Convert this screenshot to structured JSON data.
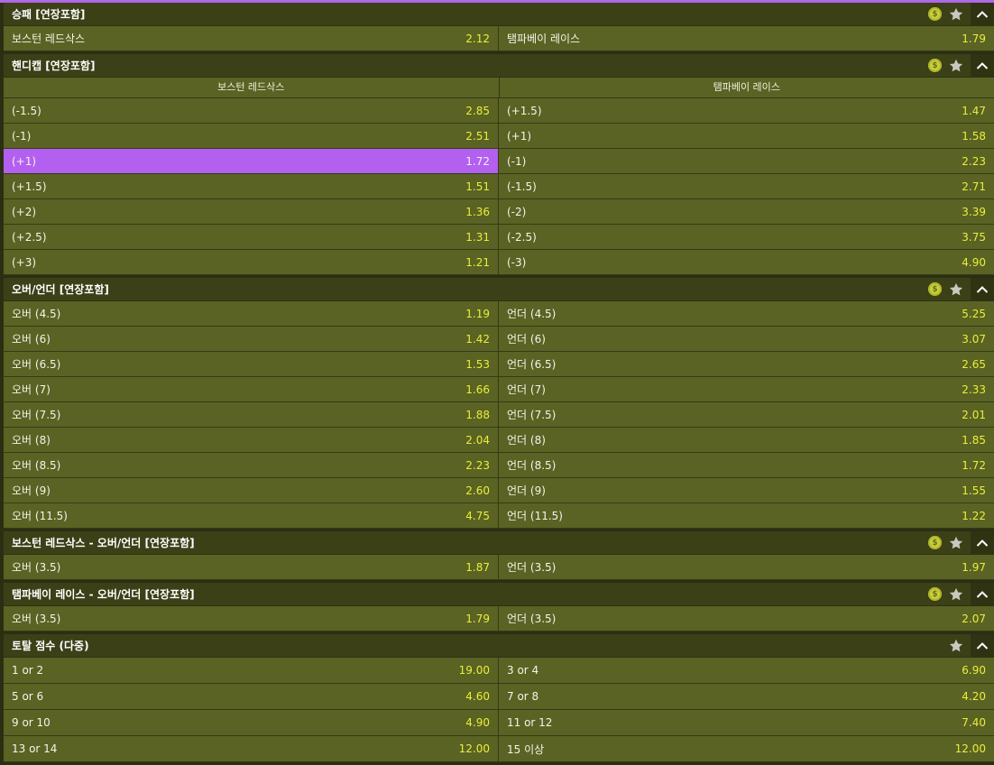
{
  "colors": {
    "accent": "#b266e8",
    "odds": "#e8ef3a",
    "row": "#5a6323",
    "header": "#3b4017"
  },
  "icons": {
    "coin": "coin-icon",
    "star": "star-icon",
    "collapse": "chevron-up-icon"
  },
  "coin_symbol": "$",
  "markets": [
    {
      "title": "승패 [연장포함]",
      "coin": true,
      "rows": [
        [
          {
            "label": "보스턴 레드삭스",
            "odds": "2.12"
          },
          {
            "label": "탬파베이 레이스",
            "odds": "1.79"
          }
        ]
      ]
    },
    {
      "title": "핸디캡 [연장포함]",
      "coin": true,
      "teams": [
        "보스턴 레드삭스",
        "탬파베이 레이스"
      ],
      "rows": [
        [
          {
            "label": "(-1.5)",
            "odds": "2.85"
          },
          {
            "label": "(+1.5)",
            "odds": "1.47"
          }
        ],
        [
          {
            "label": "(-1)",
            "odds": "2.51"
          },
          {
            "label": "(+1)",
            "odds": "1.58"
          }
        ],
        [
          {
            "label": "(+1)",
            "odds": "1.72",
            "selected": true
          },
          {
            "label": "(-1)",
            "odds": "2.23"
          }
        ],
        [
          {
            "label": "(+1.5)",
            "odds": "1.51"
          },
          {
            "label": "(-1.5)",
            "odds": "2.71"
          }
        ],
        [
          {
            "label": "(+2)",
            "odds": "1.36"
          },
          {
            "label": "(-2)",
            "odds": "3.39"
          }
        ],
        [
          {
            "label": "(+2.5)",
            "odds": "1.31"
          },
          {
            "label": "(-2.5)",
            "odds": "3.75"
          }
        ],
        [
          {
            "label": "(+3)",
            "odds": "1.21"
          },
          {
            "label": "(-3)",
            "odds": "4.90"
          }
        ]
      ]
    },
    {
      "title": "오버/언더 [연장포함]",
      "coin": true,
      "rows": [
        [
          {
            "label": "오버 (4.5)",
            "odds": "1.19"
          },
          {
            "label": "언더 (4.5)",
            "odds": "5.25"
          }
        ],
        [
          {
            "label": "오버 (6)",
            "odds": "1.42"
          },
          {
            "label": "언더 (6)",
            "odds": "3.07"
          }
        ],
        [
          {
            "label": "오버 (6.5)",
            "odds": "1.53"
          },
          {
            "label": "언더 (6.5)",
            "odds": "2.65"
          }
        ],
        [
          {
            "label": "오버 (7)",
            "odds": "1.66"
          },
          {
            "label": "언더 (7)",
            "odds": "2.33"
          }
        ],
        [
          {
            "label": "오버 (7.5)",
            "odds": "1.88"
          },
          {
            "label": "언더 (7.5)",
            "odds": "2.01"
          }
        ],
        [
          {
            "label": "오버 (8)",
            "odds": "2.04"
          },
          {
            "label": "언더 (8)",
            "odds": "1.85"
          }
        ],
        [
          {
            "label": "오버 (8.5)",
            "odds": "2.23"
          },
          {
            "label": "언더 (8.5)",
            "odds": "1.72"
          }
        ],
        [
          {
            "label": "오버 (9)",
            "odds": "2.60"
          },
          {
            "label": "언더 (9)",
            "odds": "1.55"
          }
        ],
        [
          {
            "label": "오버 (11.5)",
            "odds": "4.75"
          },
          {
            "label": "언더 (11.5)",
            "odds": "1.22"
          }
        ]
      ]
    },
    {
      "title": "보스턴 레드삭스 - 오버/언더 [연장포함]",
      "coin": true,
      "rows": [
        [
          {
            "label": "오버 (3.5)",
            "odds": "1.87"
          },
          {
            "label": "언더 (3.5)",
            "odds": "1.97"
          }
        ]
      ]
    },
    {
      "title": "탬파베이 레이스 - 오버/언더 [연장포함]",
      "coin": true,
      "rows": [
        [
          {
            "label": "오버 (3.5)",
            "odds": "1.79"
          },
          {
            "label": "언더 (3.5)",
            "odds": "2.07"
          }
        ]
      ]
    },
    {
      "title": "토탈 점수 (다중)",
      "coin": false,
      "tall": true,
      "rows": [
        [
          {
            "label": "1 or 2",
            "odds": "19.00"
          },
          {
            "label": "3 or 4",
            "odds": "6.90"
          }
        ],
        [
          {
            "label": "5 or 6",
            "odds": "4.60"
          },
          {
            "label": "7 or 8",
            "odds": "4.20"
          }
        ],
        [
          {
            "label": "9 or 10",
            "odds": "4.90"
          },
          {
            "label": "11 or 12",
            "odds": "7.40"
          }
        ],
        [
          {
            "label": "13 or 14",
            "odds": "12.00"
          },
          {
            "label": "15 이상",
            "odds": "12.00"
          }
        ]
      ]
    }
  ]
}
